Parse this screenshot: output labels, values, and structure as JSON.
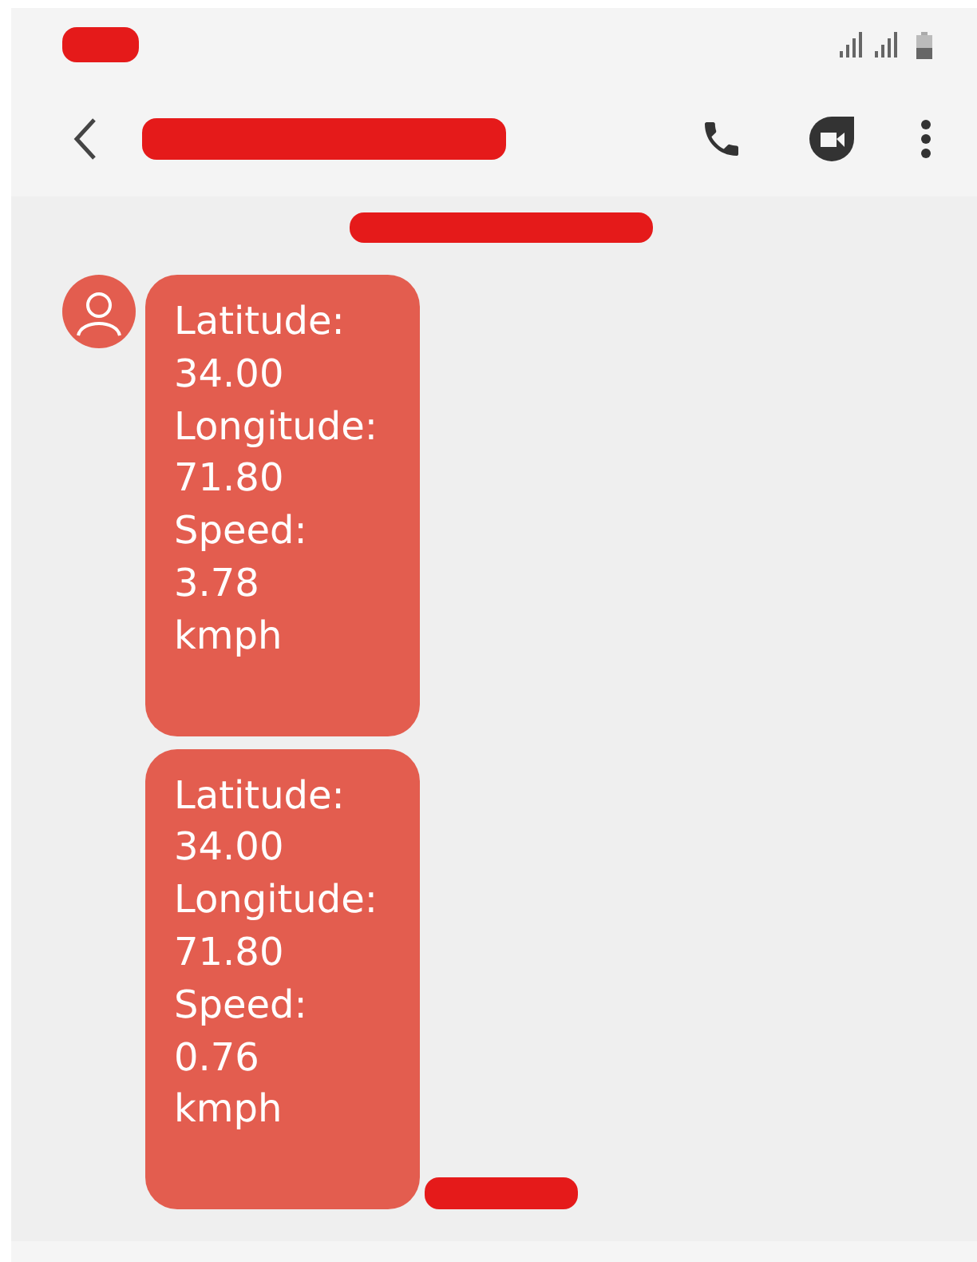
{
  "messages": [
    {
      "lines": [
        "Latitude:",
        "34.00",
        "Longitude:",
        "71.80",
        "Speed:",
        "3.78",
        "kmph"
      ],
      "show_avatar": true
    },
    {
      "lines": [
        "Latitude:",
        "34.00",
        "Longitude:",
        "71.80",
        "Speed:",
        "0.76",
        "kmph"
      ],
      "show_avatar": false
    }
  ]
}
